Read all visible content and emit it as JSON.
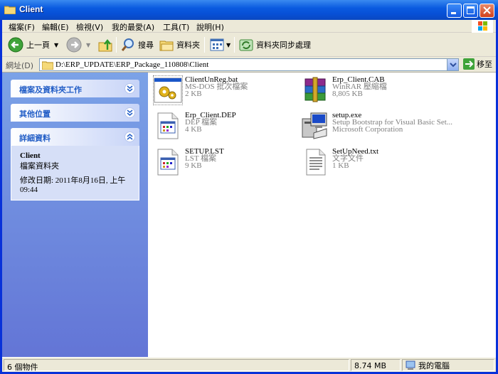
{
  "window": {
    "title": "Client"
  },
  "menu": {
    "items": [
      "檔案(F)",
      "編輯(E)",
      "檢視(V)",
      "我的最愛(A)",
      "工具(T)",
      "說明(H)"
    ]
  },
  "toolbar": {
    "back": "上一頁",
    "search": "搜尋",
    "folders": "資料夾",
    "sync": "資料夾同步處理"
  },
  "address": {
    "label": "網址(D)",
    "value": "D:\\ERP_UPDATE\\ERP_Package_110808\\Client",
    "go": "移至"
  },
  "left": {
    "tasks_title": "檔案及資料夾工作",
    "places_title": "其他位置",
    "details_title": "詳細資料",
    "details_name": "Client",
    "details_type": "檔案資料夾",
    "details_modified": "修改日期: 2011年8月16日, 上午 09:44"
  },
  "files": [
    {
      "name": "ClientUnReg.bat",
      "type": "MS-DOS 批次檔案",
      "size": "2 KB",
      "icon": "batch-file-icon"
    },
    {
      "name": "Erp_Client.CAB",
      "type": "WinRAR 壓縮檔",
      "size": "8,805 KB",
      "icon": "winrar-archive-icon"
    },
    {
      "name": "Erp_Client.DEP",
      "type": "DEP 檔案",
      "size": "4 KB",
      "icon": "generic-file-icon"
    },
    {
      "name": "setup.exe",
      "type": "Setup Bootstrap for Visual Basic Set...",
      "size": "Microsoft Corporation",
      "icon": "setup-exe-icon"
    },
    {
      "name": "SETUP.LST",
      "type": "LST 檔案",
      "size": "9 KB",
      "icon": "generic-file-icon"
    },
    {
      "name": "SetUpNeed.txt",
      "type": "文字文件",
      "size": "1 KB",
      "icon": "text-file-icon"
    }
  ],
  "status": {
    "count": "6 個物件",
    "size": "8.74 MB",
    "location": "我的電腦"
  },
  "colors": {
    "titlebar": "#0a5be0",
    "leftpane": "#6f8de0",
    "panel_title": "#215dc6"
  }
}
